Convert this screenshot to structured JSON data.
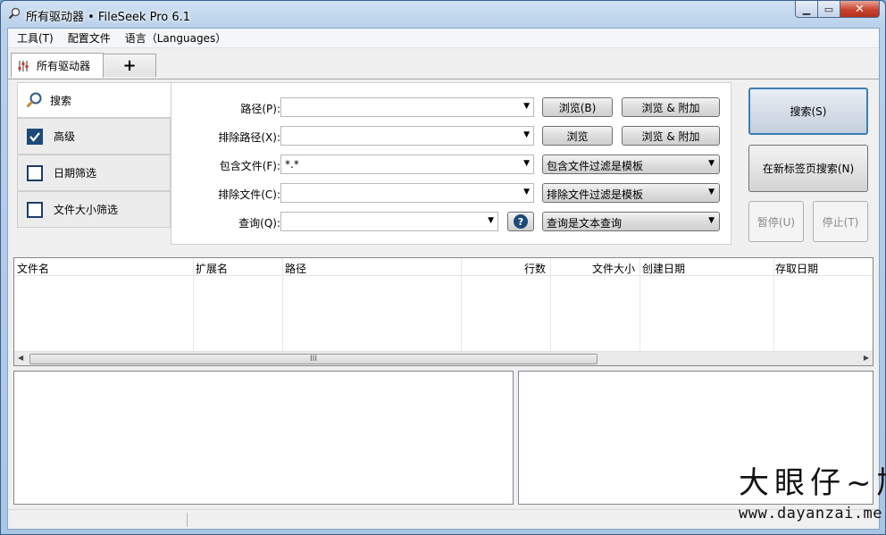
{
  "window": {
    "title": "所有驱动器 • FileSeek Pro 6.1"
  },
  "menu": [
    "工具(T)",
    "配置文件",
    "语言（Languages）"
  ],
  "tabs": {
    "active_label": "所有驱动器",
    "add_label": "+"
  },
  "sidebar": {
    "search_label": "搜索",
    "items": [
      {
        "label": "高级",
        "checked": true
      },
      {
        "label": "日期筛选",
        "checked": false
      },
      {
        "label": "文件大小筛选",
        "checked": false
      }
    ]
  },
  "form": {
    "path_label": "路径(P):",
    "path_value": "",
    "exclude_path_label": "排除路径(X):",
    "exclude_path_value": "",
    "include_files_label": "包含文件(F):",
    "include_files_value": "*.*",
    "exclude_files_label": "排除文件(C):",
    "exclude_files_value": "",
    "query_label": "查询(Q):",
    "query_value": "",
    "browse_b_label": "浏览(B)",
    "browse_append_label": "浏览 & 附加",
    "browse_label": "浏览",
    "browse_append2_label": "浏览 & 附加",
    "include_mode": "包含文件过滤是模板",
    "exclude_mode": "排除文件过滤是模板",
    "query_mode": "查询是文本查询",
    "help_glyph": "?"
  },
  "actions": {
    "search": "搜索(S)",
    "search_new_tab": "在新标签页搜索(N)",
    "pause": "暂停(U)",
    "stop": "停止(T)"
  },
  "results": {
    "columns": [
      "文件名",
      "扩展名",
      "路径",
      "行数",
      "文件大小",
      "创建日期",
      "存取日期"
    ],
    "scroll_grip": "III"
  },
  "watermark": {
    "big": "大眼仔~旭",
    "url": "www.dayanzai.me"
  }
}
